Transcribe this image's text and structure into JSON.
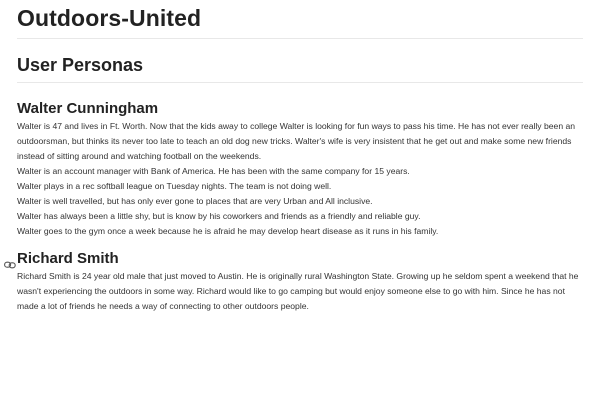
{
  "site": {
    "title": "Outdoors-United"
  },
  "section": {
    "title": "User Personas"
  },
  "personas": [
    {
      "name": "Walter Cunningham",
      "paragraphs": [
        "Walter is 47 and lives in Ft. Worth. Now that the kids away to college Walter is looking for fun ways to pass his time. He has not ever really been an outdoorsman, but thinks its never too late to teach an old dog new tricks. Walter's wife is very insistent that he get out and make some new friends instead of sitting around and watching football on the weekends.",
        "Walter is an account manager with Bank of America. He has been with the same company for 15 years.",
        "Walter plays in a rec softball league on Tuesday nights. The team is not doing well.",
        "Walter is well travelled, but has only ever gone to places that are very Urban and All inclusive.",
        "Walter has always been a little shy, but is know by his coworkers and friends as a friendly and reliable guy.",
        "Walter goes to the gym once a week because he is afraid he may develop heart disease as it runs in his family."
      ]
    },
    {
      "name": "Richard Smith",
      "anchor_icon": "link-icon",
      "paragraphs": [
        "Richard Smith is 24 year old male that just moved to Austin. He is originally rural Washington State. Growing up he seldom spent a weekend that he wasn't experiencing the outdoors in some way. Richard would like to go camping but would enjoy someone else to go with him. Since he has not made a lot of friends he needs a way of connecting to other outdoors people."
      ]
    }
  ]
}
